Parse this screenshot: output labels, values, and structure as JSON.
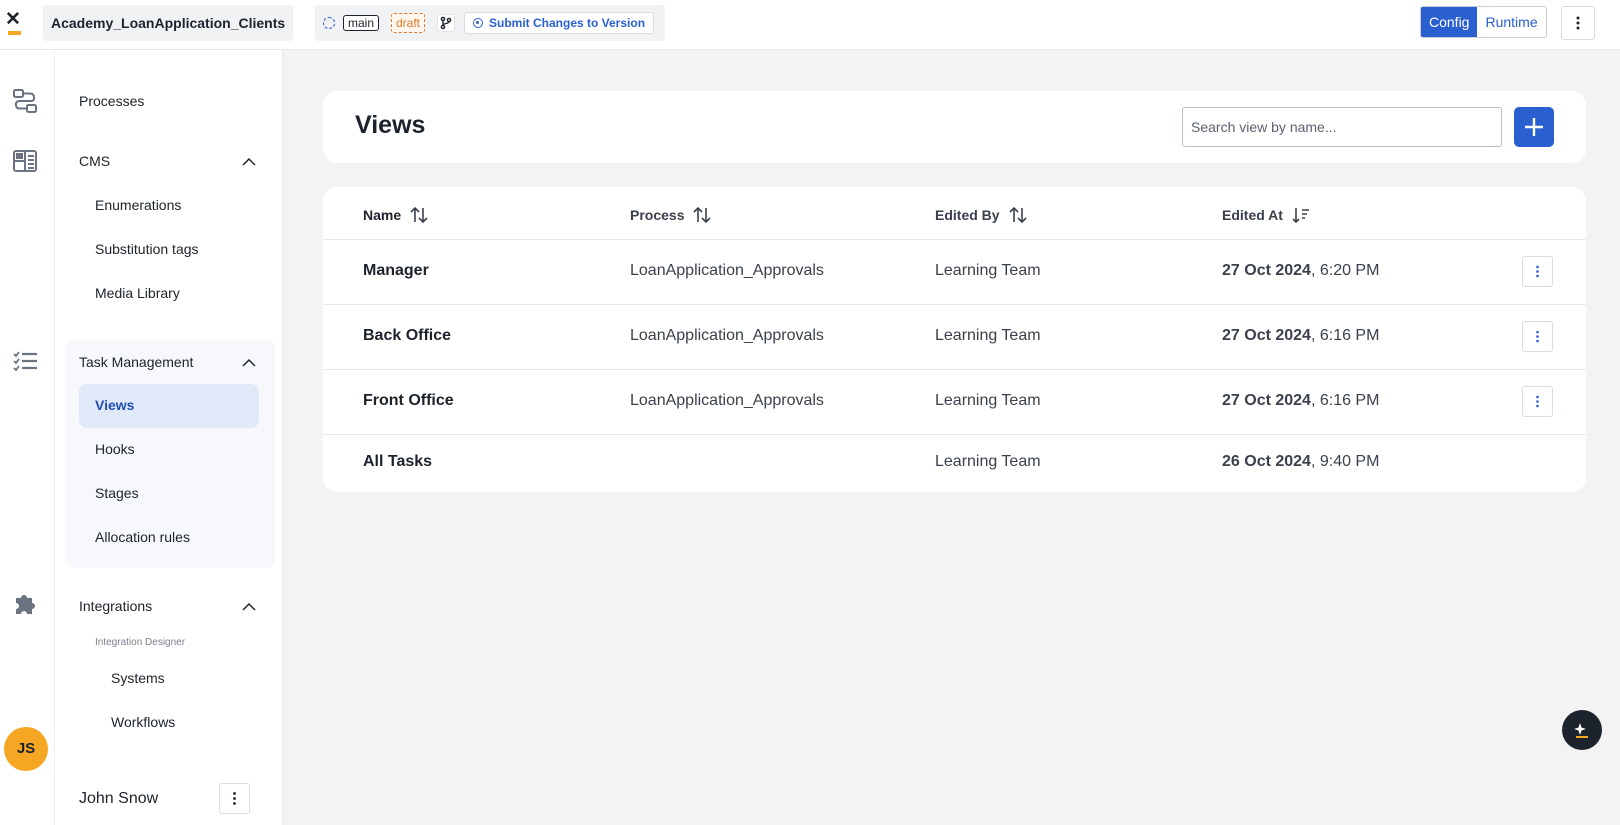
{
  "topbar": {
    "project_name": "Academy_LoanApplication_Clients",
    "branch": "main",
    "status": "draft",
    "submit_label": "Submit Changes to Version",
    "modes": [
      "Config",
      "Runtime"
    ],
    "active_mode": "Config",
    "accent": "#2a5fd0"
  },
  "rail": {
    "icons": [
      "processes-icon",
      "cms-icon",
      "task-management-icon",
      "integrations-icon"
    ]
  },
  "sidebar": {
    "processes": "Processes",
    "cms": {
      "label": "CMS",
      "items": [
        "Enumerations",
        "Substitution tags",
        "Media Library"
      ]
    },
    "task_management": {
      "label": "Task Management",
      "items": [
        "Views",
        "Hooks",
        "Stages",
        "Allocation rules"
      ],
      "active": "Views"
    },
    "integrations": {
      "label": "Integrations",
      "subheading": "Integration Designer",
      "items": [
        "Systems",
        "Workflows"
      ]
    },
    "user": {
      "initials": "JS",
      "name": "John Snow"
    }
  },
  "main": {
    "title": "Views",
    "search_placeholder": "Search view by name...",
    "table": {
      "headers": {
        "name": "Name",
        "process": "Process",
        "edited_by": "Edited By",
        "edited_at": "Edited At"
      },
      "rows": [
        {
          "name": "Manager",
          "process": "LoanApplication_Approvals",
          "edited_by": "Learning Team",
          "date": "27 Oct 2024",
          "time": ", 6:20 PM"
        },
        {
          "name": "Back Office",
          "process": "LoanApplication_Approvals",
          "edited_by": "Learning Team",
          "date": "27 Oct 2024",
          "time": ", 6:16 PM"
        },
        {
          "name": "Front Office",
          "process": "LoanApplication_Approvals",
          "edited_by": "Learning Team",
          "date": "27 Oct 2024",
          "time": ", 6:16 PM"
        },
        {
          "name": "All Tasks",
          "process": "",
          "edited_by": "Learning Team",
          "date": "26 Oct 2024",
          "time": ", 9:40 PM"
        }
      ]
    }
  }
}
